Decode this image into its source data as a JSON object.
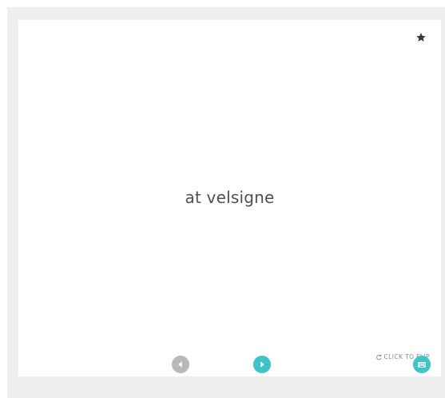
{
  "flashcard": {
    "term": "at velsigne",
    "flip_label": "CLICK TO FLIP"
  },
  "icons": {
    "star": "star-icon",
    "flip": "rotate-icon",
    "prev": "arrow-left-icon",
    "next": "arrow-right-icon",
    "keyboard": "keyboard-icon"
  },
  "colors": {
    "background": "#efefef",
    "card": "#ffffff",
    "accent": "#3ec4c8",
    "disabled": "#b8b8b8",
    "text": "#4f4f4f"
  }
}
